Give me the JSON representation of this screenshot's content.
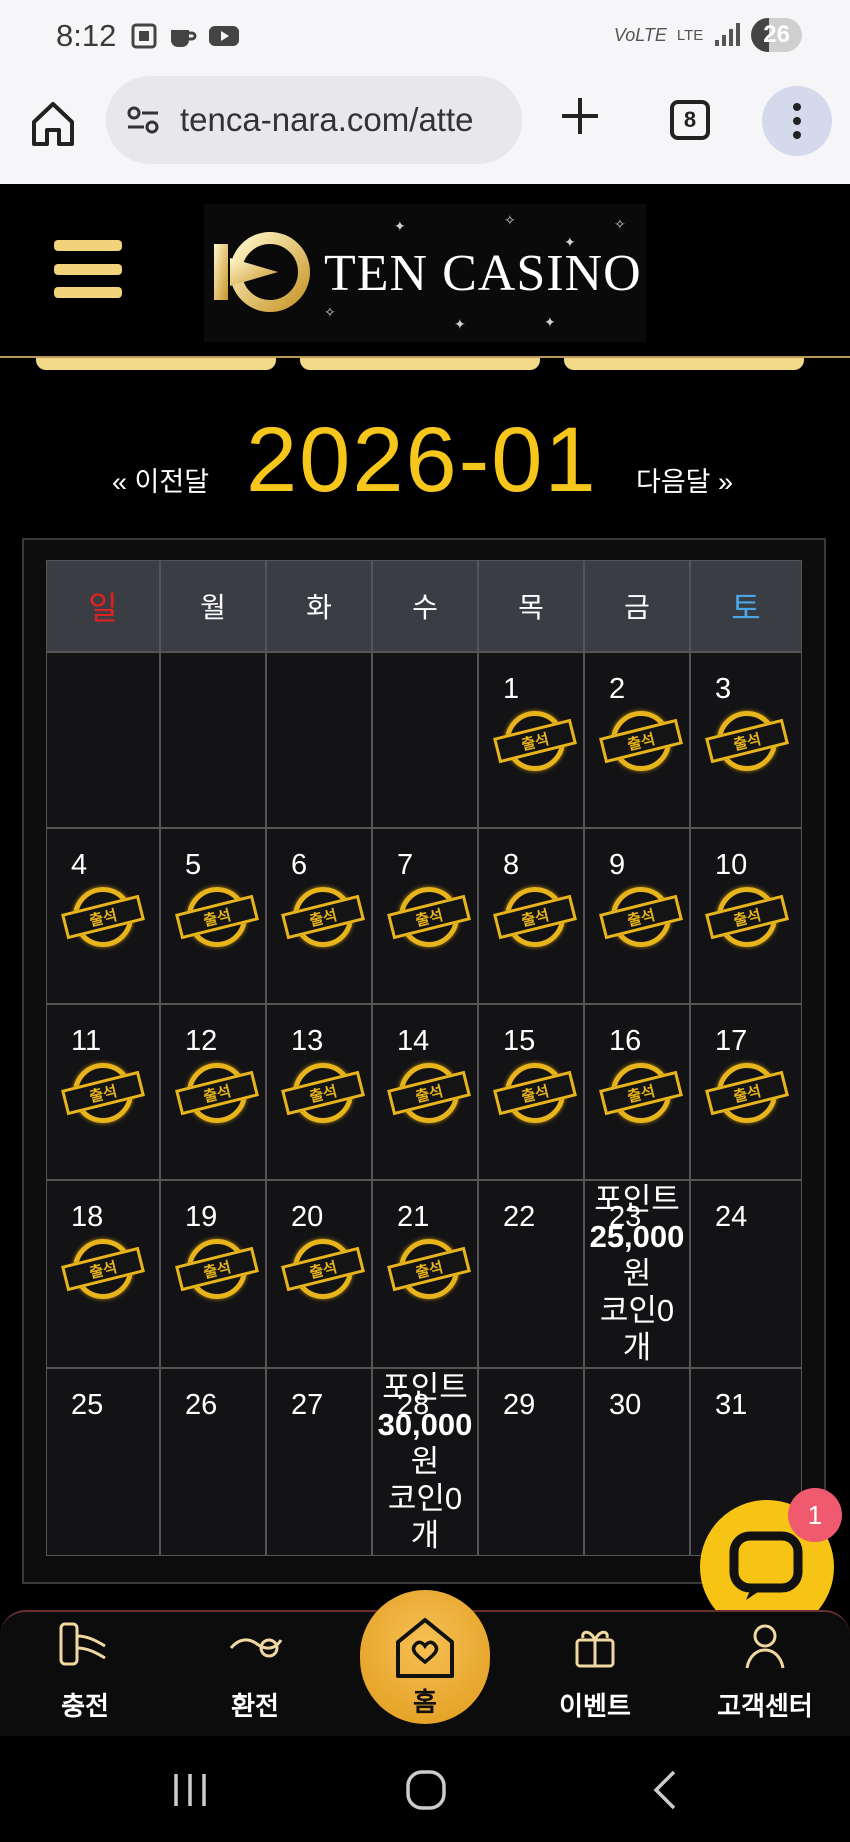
{
  "status_bar": {
    "time": "8:12",
    "battery": "26",
    "network": "LTE"
  },
  "browser": {
    "url": "tenca-nara.com/atte",
    "tab_count": "8"
  },
  "header": {
    "logo_text": "TEN CASINO"
  },
  "calendar": {
    "prev_label": "« 이전달",
    "month": "2026-01",
    "next_label": "다음달 »",
    "weekdays": [
      "일",
      "월",
      "화",
      "수",
      "목",
      "금",
      "토"
    ],
    "stamp_label": "출석",
    "weeks": [
      [
        {
          "day": ""
        },
        {
          "day": ""
        },
        {
          "day": ""
        },
        {
          "day": ""
        },
        {
          "day": "1",
          "stamp": true
        },
        {
          "day": "2",
          "stamp": true
        },
        {
          "day": "3",
          "stamp": true
        }
      ],
      [
        {
          "day": "4",
          "stamp": true
        },
        {
          "day": "5",
          "stamp": true
        },
        {
          "day": "6",
          "stamp": true
        },
        {
          "day": "7",
          "stamp": true
        },
        {
          "day": "8",
          "stamp": true
        },
        {
          "day": "9",
          "stamp": true
        },
        {
          "day": "10",
          "stamp": true
        }
      ],
      [
        {
          "day": "11",
          "stamp": true
        },
        {
          "day": "12",
          "stamp": true
        },
        {
          "day": "13",
          "stamp": true
        },
        {
          "day": "14",
          "stamp": true
        },
        {
          "day": "15",
          "stamp": true
        },
        {
          "day": "16",
          "stamp": true
        },
        {
          "day": "17",
          "stamp": true
        }
      ],
      [
        {
          "day": "18",
          "stamp": true
        },
        {
          "day": "19",
          "stamp": true
        },
        {
          "day": "20",
          "stamp": true
        },
        {
          "day": "21",
          "stamp": true
        },
        {
          "day": "22"
        },
        {
          "day": "23",
          "reward": [
            "포인트",
            "25,000",
            "원",
            "코인0",
            "개"
          ]
        },
        {
          "day": "24"
        }
      ],
      [
        {
          "day": "25"
        },
        {
          "day": "26"
        },
        {
          "day": "27"
        },
        {
          "day": "28",
          "reward": [
            "포인트",
            "30,000",
            "원",
            "코인0",
            "개"
          ]
        },
        {
          "day": "29"
        },
        {
          "day": "30"
        },
        {
          "day": "31"
        }
      ]
    ]
  },
  "bottom_nav": {
    "charge": "충전",
    "exchange": "환전",
    "home": "홈",
    "event": "이벤트",
    "support": "고객센터"
  },
  "chat": {
    "badge": "1"
  },
  "colors": {
    "gold": "#f6c61a",
    "sunday": "#e0211f",
    "saturday": "#4aa6e6",
    "stamp": "#e7b41c"
  }
}
